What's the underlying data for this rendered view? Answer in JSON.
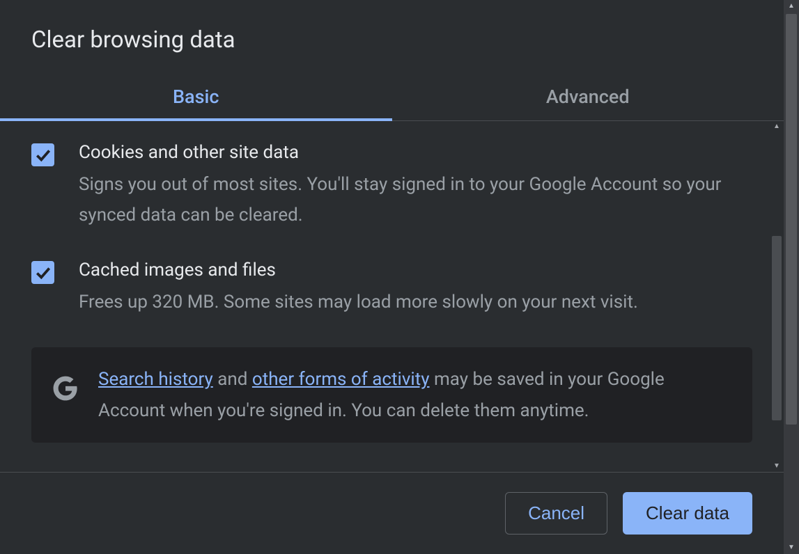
{
  "dialog": {
    "title": "Clear browsing data"
  },
  "tabs": {
    "basic": "Basic",
    "advanced": "Advanced"
  },
  "options": {
    "cookies": {
      "title": "Cookies and other site data",
      "desc": "Signs you out of most sites. You'll stay signed in to your Google Account so your synced data can be cleared.",
      "checked": true
    },
    "cache": {
      "title": "Cached images and files",
      "desc": "Frees up 320 MB. Some sites may load more slowly on your next visit.",
      "checked": true
    }
  },
  "info": {
    "link1": "Search history",
    "mid1": " and ",
    "link2": "other forms of activity",
    "rest": " may be saved in your Google Account when you're signed in. You can delete them anytime."
  },
  "footer": {
    "cancel": "Cancel",
    "clear": "Clear data"
  }
}
